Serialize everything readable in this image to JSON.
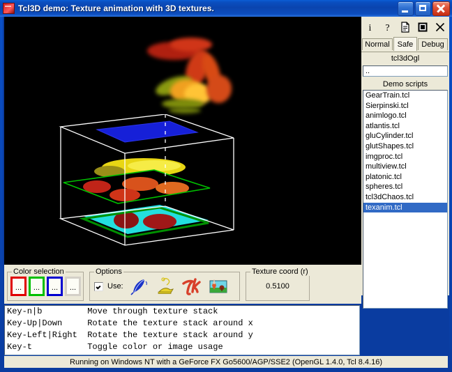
{
  "window": {
    "title": "Tcl3D demo: Texture animation with 3D textures.",
    "app_icon": "tcl3d-icon",
    "buttons": {
      "minimize": "minimize",
      "maximize": "maximize",
      "close": "close"
    }
  },
  "toolbar": {
    "items": [
      {
        "name": "info-icon",
        "glyph": "i",
        "label": "Info"
      },
      {
        "name": "help-icon",
        "glyph": "?",
        "label": "Help"
      },
      {
        "name": "document-icon",
        "glyph": "doc",
        "label": "Source"
      },
      {
        "name": "window-icon",
        "glyph": "square",
        "label": "Window"
      },
      {
        "name": "close-icon",
        "glyph": "X",
        "label": "Close"
      }
    ]
  },
  "tabs": [
    {
      "label": "Normal",
      "selected": false
    },
    {
      "label": "Safe",
      "selected": true
    },
    {
      "label": "Debug",
      "selected": false
    }
  ],
  "right_panel": {
    "dir_label": "tcl3dOgl",
    "dir_entries": [
      ".."
    ],
    "scripts_label": "Demo scripts",
    "scripts": [
      {
        "name": "GearTrain.tcl",
        "selected": false
      },
      {
        "name": "Sierpinski.tcl",
        "selected": false
      },
      {
        "name": "animlogo.tcl",
        "selected": false
      },
      {
        "name": "atlantis.tcl",
        "selected": false
      },
      {
        "name": "gluCylinder.tcl",
        "selected": false
      },
      {
        "name": "glutShapes.tcl",
        "selected": false
      },
      {
        "name": "imgproc.tcl",
        "selected": false
      },
      {
        "name": "multiview.tcl",
        "selected": false
      },
      {
        "name": "platonic.tcl",
        "selected": false
      },
      {
        "name": "spheres.tcl",
        "selected": false
      },
      {
        "name": "tcl3dChaos.tcl",
        "selected": false
      },
      {
        "name": "texanim.tcl",
        "selected": true
      }
    ]
  },
  "controls": {
    "color_group": {
      "title": "Color selection",
      "buttons": [
        {
          "label": "...",
          "color": "#e00000"
        },
        {
          "label": "...",
          "color": "#00c000"
        },
        {
          "label": "...",
          "color": "#0000d0"
        },
        {
          "label": "...",
          "color": "#d4d0c8"
        }
      ]
    },
    "options_group": {
      "title": "Options",
      "checkbox_label": "Use:",
      "checkbox_checked": true,
      "icons": [
        {
          "name": "feather-icon",
          "label": "Tcl feather"
        },
        {
          "name": "lamp-icon",
          "label": "Tcl lamp"
        },
        {
          "name": "tk-logo-icon",
          "label": "Tk logo"
        },
        {
          "name": "image-icon",
          "label": "Image"
        }
      ]
    },
    "texture_group": {
      "title": "Texture coord (r)",
      "value": "0.5100"
    }
  },
  "key_help": {
    "lines": [
      "Key-n|b         Move through texture stack",
      "Key-Up|Down     Rotate the texture stack around x",
      "Key-Left|Right  Rotate the texture stack around y",
      "Key-t           Toggle color or image usage"
    ]
  },
  "status": {
    "text": "Running on Windows NT with a GeForce FX Go5600/AGP/SSE2 (OpenGL 1.4.0, Tcl 8.4.16)"
  },
  "colors": {
    "titlebar_blue": "#0a4fc0",
    "panel_face": "#ece9d8",
    "selection_blue": "#316ac5",
    "canvas_black": "#000000",
    "cube_wire": "#ffffff",
    "slice_green": "#00b000"
  }
}
